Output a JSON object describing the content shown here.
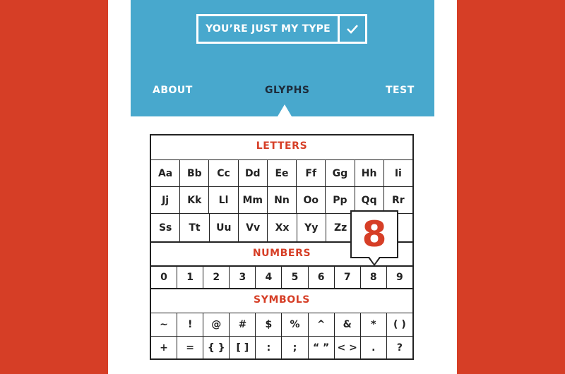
{
  "header": {
    "title": "YOU’RE JUST MY TYPE",
    "check_icon": "check-icon",
    "tabs": [
      {
        "label": "ABOUT"
      },
      {
        "label": "GLYPHS"
      },
      {
        "label": "TEST"
      }
    ],
    "active_tab": "GLYPHS"
  },
  "glyphs": {
    "letters_title": "LETTERS",
    "letters_rows": [
      [
        "Aa",
        "Bb",
        "Cc",
        "Dd",
        "Ee",
        "Ff",
        "Gg",
        "Hh",
        "Ii"
      ],
      [
        "Jj",
        "Kk",
        "Ll",
        "Mm",
        "Nn",
        "Oo",
        "Pp",
        "Qq",
        "Rr"
      ],
      [
        "Ss",
        "Tt",
        "Uu",
        "Vv",
        "Xx",
        "Yy",
        "Zz"
      ]
    ],
    "numbers_title": "NUMBERS",
    "numbers": [
      "0",
      "1",
      "2",
      "3",
      "4",
      "5",
      "6",
      "7",
      "8",
      "9"
    ],
    "symbols_title": "SYMBOLS",
    "symbols_rows": [
      [
        "~",
        "!",
        "@",
        "#",
        "$",
        "%",
        "^",
        "&",
        "*",
        "( )"
      ],
      [
        "+",
        "=",
        "{ }",
        "[ ]",
        ":",
        ";",
        "“ ”",
        "< >",
        ".",
        "?"
      ]
    ],
    "magnified_glyph": "8"
  },
  "colors": {
    "background": "#D63E26",
    "header": "#48A8CD",
    "accent": "#D63E26",
    "ink": "#222222",
    "active_tab": "#1d2b3a"
  }
}
